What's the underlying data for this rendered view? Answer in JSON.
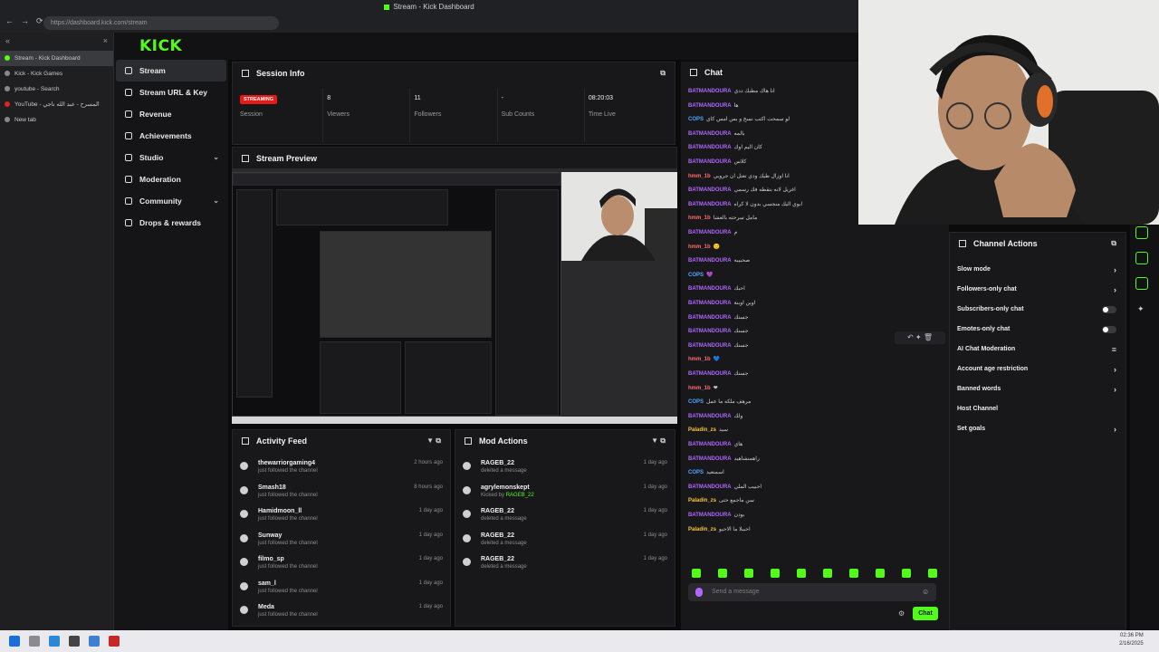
{
  "browser": {
    "window_title": "Stream - Kick Dashboard",
    "address": "https://dashboard.kick.com/stream",
    "tabs": [
      {
        "label": "Stream - Kick Dashboard",
        "active": true
      },
      {
        "label": "Kick - Kick Games",
        "active": false
      },
      {
        "label": "youtube - Search",
        "active": false
      },
      {
        "label": "YouTube - المسرح - عبد الله ناجي",
        "active": false
      },
      {
        "label": "New tab",
        "active": false
      }
    ]
  },
  "kick": {
    "logo": "KICK",
    "sidebar": [
      {
        "label": "Stream",
        "icon": "stream-icon",
        "active": true,
        "chevron": false
      },
      {
        "label": "Stream URL & Key",
        "icon": "key-icon",
        "active": false,
        "chevron": false
      },
      {
        "label": "Revenue",
        "icon": "revenue-icon",
        "active": false,
        "chevron": false
      },
      {
        "label": "Achievements",
        "icon": "trophy-icon",
        "active": false,
        "chevron": false
      },
      {
        "label": "Studio",
        "icon": "studio-icon",
        "active": false,
        "chevron": true
      },
      {
        "label": "Moderation",
        "icon": "hammer-icon",
        "active": false,
        "chevron": false
      },
      {
        "label": "Community",
        "icon": "community-icon",
        "active": false,
        "chevron": true
      },
      {
        "label": "Drops & rewards",
        "icon": "gift-icon",
        "active": false,
        "chevron": false
      }
    ],
    "session": {
      "title": "Session Info",
      "stats": [
        {
          "value": "STREAMING",
          "label": "Session",
          "badge": true
        },
        {
          "value": "8",
          "label": "Viewers",
          "badge": false
        },
        {
          "value": "11",
          "label": "Followers",
          "badge": false
        },
        {
          "value": "-",
          "label": "Sub Counts",
          "badge": false
        },
        {
          "value": "08:20:03",
          "label": "Time Live",
          "badge": false
        }
      ]
    },
    "preview": {
      "title": "Stream Preview"
    },
    "activity": {
      "title": "Activity Feed",
      "items": [
        {
          "name": "thewarriorgaming4",
          "sub": "just followed the channel",
          "time": "2 hours ago"
        },
        {
          "name": "Smash18",
          "sub": "just followed the channel",
          "time": "8 hours ago"
        },
        {
          "name": "Hamidmoon_ll",
          "sub": "just followed the channel",
          "time": "1 day ago"
        },
        {
          "name": "Sunway",
          "sub": "just followed the channel",
          "time": "1 day ago"
        },
        {
          "name": "filmo_sp",
          "sub": "just followed the channel",
          "time": "1 day ago"
        },
        {
          "name": "sam_l",
          "sub": "just followed the channel",
          "time": "1 day ago"
        },
        {
          "name": "Meda",
          "sub": "just followed the channel",
          "time": "1 day ago"
        }
      ]
    },
    "mod": {
      "title": "Mod Actions",
      "items": [
        {
          "name": "RAGEB_22",
          "sub": "deleted a message",
          "by": "",
          "time": "1 day ago"
        },
        {
          "name": "agrylemonskept",
          "sub": "Kicked by ",
          "by": "RAGEB_22",
          "time": "1 day ago"
        },
        {
          "name": "RAGEB_22",
          "sub": "deleted a message",
          "by": "",
          "time": "1 day ago"
        },
        {
          "name": "RAGEB_22",
          "sub": "deleted a message",
          "by": "",
          "time": "1 day ago"
        },
        {
          "name": "RAGEB_22",
          "sub": "deleted a message",
          "by": "",
          "time": "1 day ago"
        }
      ]
    },
    "chat": {
      "title": "Chat",
      "input_placeholder": "Send a message",
      "send_label": "Chat",
      "messages": [
        {
          "user": "BATMANDOURA",
          "msg": "انا هاك مطبك ددي"
        },
        {
          "user": "BATMANDOURA",
          "msg": "ها"
        },
        {
          "user": "COPS",
          "msg": "لو سمحت اكتب نسخ و بس امس كاي"
        },
        {
          "user": "BATMANDOURA",
          "msg": "بالمه"
        },
        {
          "user": "BATMANDOURA",
          "msg": "كان اليم اوك"
        },
        {
          "user": "BATMANDOURA",
          "msg": "كلاس"
        },
        {
          "user": "hmm_1b",
          "msg": "انا اوزال طيك ودي تعتل ان جروبي"
        },
        {
          "user": "BATMANDOURA",
          "msg": "اغزيل لانه بتقطه فك رسمي"
        },
        {
          "user": "BATMANDOURA",
          "msg": "ابوي اليك منجسي بدون لا كراه"
        },
        {
          "user": "hmm_1b",
          "msg": "مامل سرحته بالعشا"
        },
        {
          "user": "BATMANDOURA",
          "msg": "م"
        },
        {
          "user": "hmm_1b",
          "msg": "🙂"
        },
        {
          "user": "BATMANDOURA",
          "msg": "صحبيبه"
        },
        {
          "user": "COPS",
          "msg": "💜"
        },
        {
          "user": "BATMANDOURA",
          "msg": "احبك"
        },
        {
          "user": "BATMANDOURA",
          "msg": "اوبن اوبنة"
        },
        {
          "user": "BATMANDOURA",
          "msg": "جسنك"
        },
        {
          "user": "BATMANDOURA",
          "msg": "جسنك"
        },
        {
          "user": "BATMANDOURA",
          "msg": "جسنك"
        },
        {
          "user": "hmm_1b",
          "msg": "💙"
        },
        {
          "user": "BATMANDOURA",
          "msg": "جسنك"
        },
        {
          "user": "hmm_1b",
          "msg": "❤"
        },
        {
          "user": "COPS",
          "msg": "مرهف ملكه ما عمل"
        },
        {
          "user": "BATMANDOURA",
          "msg": "ولك"
        },
        {
          "user": "Paladin_zs",
          "msg": "سيد"
        },
        {
          "user": "BATMANDOURA",
          "msg": "هاي"
        },
        {
          "user": "BATMANDOURA",
          "msg": "راهمنشاهيد"
        },
        {
          "user": "COPS",
          "msg": "اسمنعيد"
        },
        {
          "user": "BATMANDOURA",
          "msg": "احبيب الملي"
        },
        {
          "user": "Paladin_zs",
          "msg": "سن ماجمع حتى"
        },
        {
          "user": "BATMANDOURA",
          "msg": "بودن"
        },
        {
          "user": "Paladin_zs",
          "msg": "احببلا ما الاحيو"
        }
      ]
    },
    "channel_actions": {
      "title": "Channel Actions",
      "items": [
        {
          "label": "Slow mode",
          "control": "arrow",
          "glyph": "›"
        },
        {
          "label": "Followers-only chat",
          "control": "arrow",
          "glyph": "›"
        },
        {
          "label": "Subscribers-only chat",
          "control": "toggle",
          "glyph": ""
        },
        {
          "label": "Emotes-only chat",
          "control": "toggle",
          "glyph": ""
        },
        {
          "label": "AI Chat Moderation",
          "control": "arrow",
          "glyph": "≡"
        },
        {
          "label": "Account age restriction",
          "control": "arrow",
          "glyph": "›"
        },
        {
          "label": "Banned words",
          "control": "arrow",
          "glyph": "›"
        },
        {
          "label": "Host Channel",
          "control": "none",
          "glyph": ""
        },
        {
          "label": "Set goals",
          "control": "arrow",
          "glyph": "›"
        }
      ]
    }
  },
  "taskbar": {
    "time": "02:36 PM",
    "date": "2/16/2025"
  }
}
